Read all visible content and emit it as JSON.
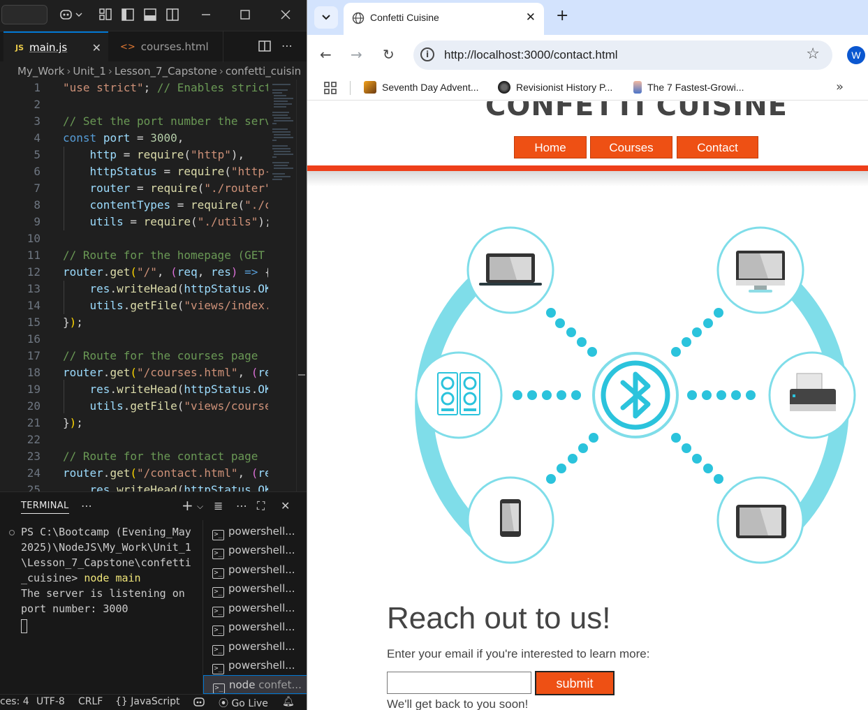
{
  "vscode": {
    "tabs": [
      {
        "label": "main.js",
        "icon": "JS"
      },
      {
        "label": "courses.html",
        "icon": "<>"
      }
    ],
    "breadcrumb": [
      "My_Work",
      "Unit_1",
      "Lesson_7_Capstone",
      "confetti_cuisin"
    ],
    "line_numbers": [
      "1",
      "2",
      "3",
      "4",
      "5",
      "6",
      "7",
      "8",
      "9",
      "10",
      "11",
      "12",
      "13",
      "14",
      "15",
      "16",
      "17",
      "18",
      "19",
      "20",
      "21",
      "22",
      "23",
      "24",
      "25"
    ],
    "terminal": {
      "tab_label": "TERMINAL",
      "lines": [
        "PS C:\\Bootcamp (Evening_May",
        "2025)\\NodeJS\\My_Work\\Unit_1",
        "\\Lesson_7_Capstone\\confetti",
        "_cuisine> "
      ],
      "command": "node main",
      "output": [
        "The server is listening on",
        "port number: 3000"
      ],
      "instances": [
        "powershell...",
        "powershell...",
        "powershell...",
        "powershell...",
        "powershell...",
        "powershell...",
        "powershell...",
        "powershell..."
      ],
      "active_instance": {
        "name": "node",
        "detail": "confet..."
      }
    },
    "statusbar": {
      "spaces": "ces: 4",
      "encoding": "UTF-8",
      "eol": "CRLF",
      "language": "JavaScript",
      "language_icon": "{}",
      "golive": "Go Live"
    }
  },
  "browser": {
    "tab_title": "Confetti Cuisine",
    "url": "http://localhost:3000/contact.html",
    "profile_initial": "W",
    "bookmarks": [
      "Seventh Day Advent...",
      "Revisionist History P...",
      "The 7 Fastest-Growi..."
    ],
    "colors": {
      "accent": "#ee5014",
      "bar": "#ee3f1a",
      "bluetooth": "#2bc3dc"
    }
  },
  "site": {
    "logo": "CONFETTI CUISINE",
    "nav": [
      "Home",
      "Courses",
      "Contact"
    ],
    "contact_title": "Reach out to us!",
    "contact_sub": "Enter your email if you're interested to learn more:",
    "submit": "submit",
    "footer_note": "We'll get back to you soon!"
  }
}
